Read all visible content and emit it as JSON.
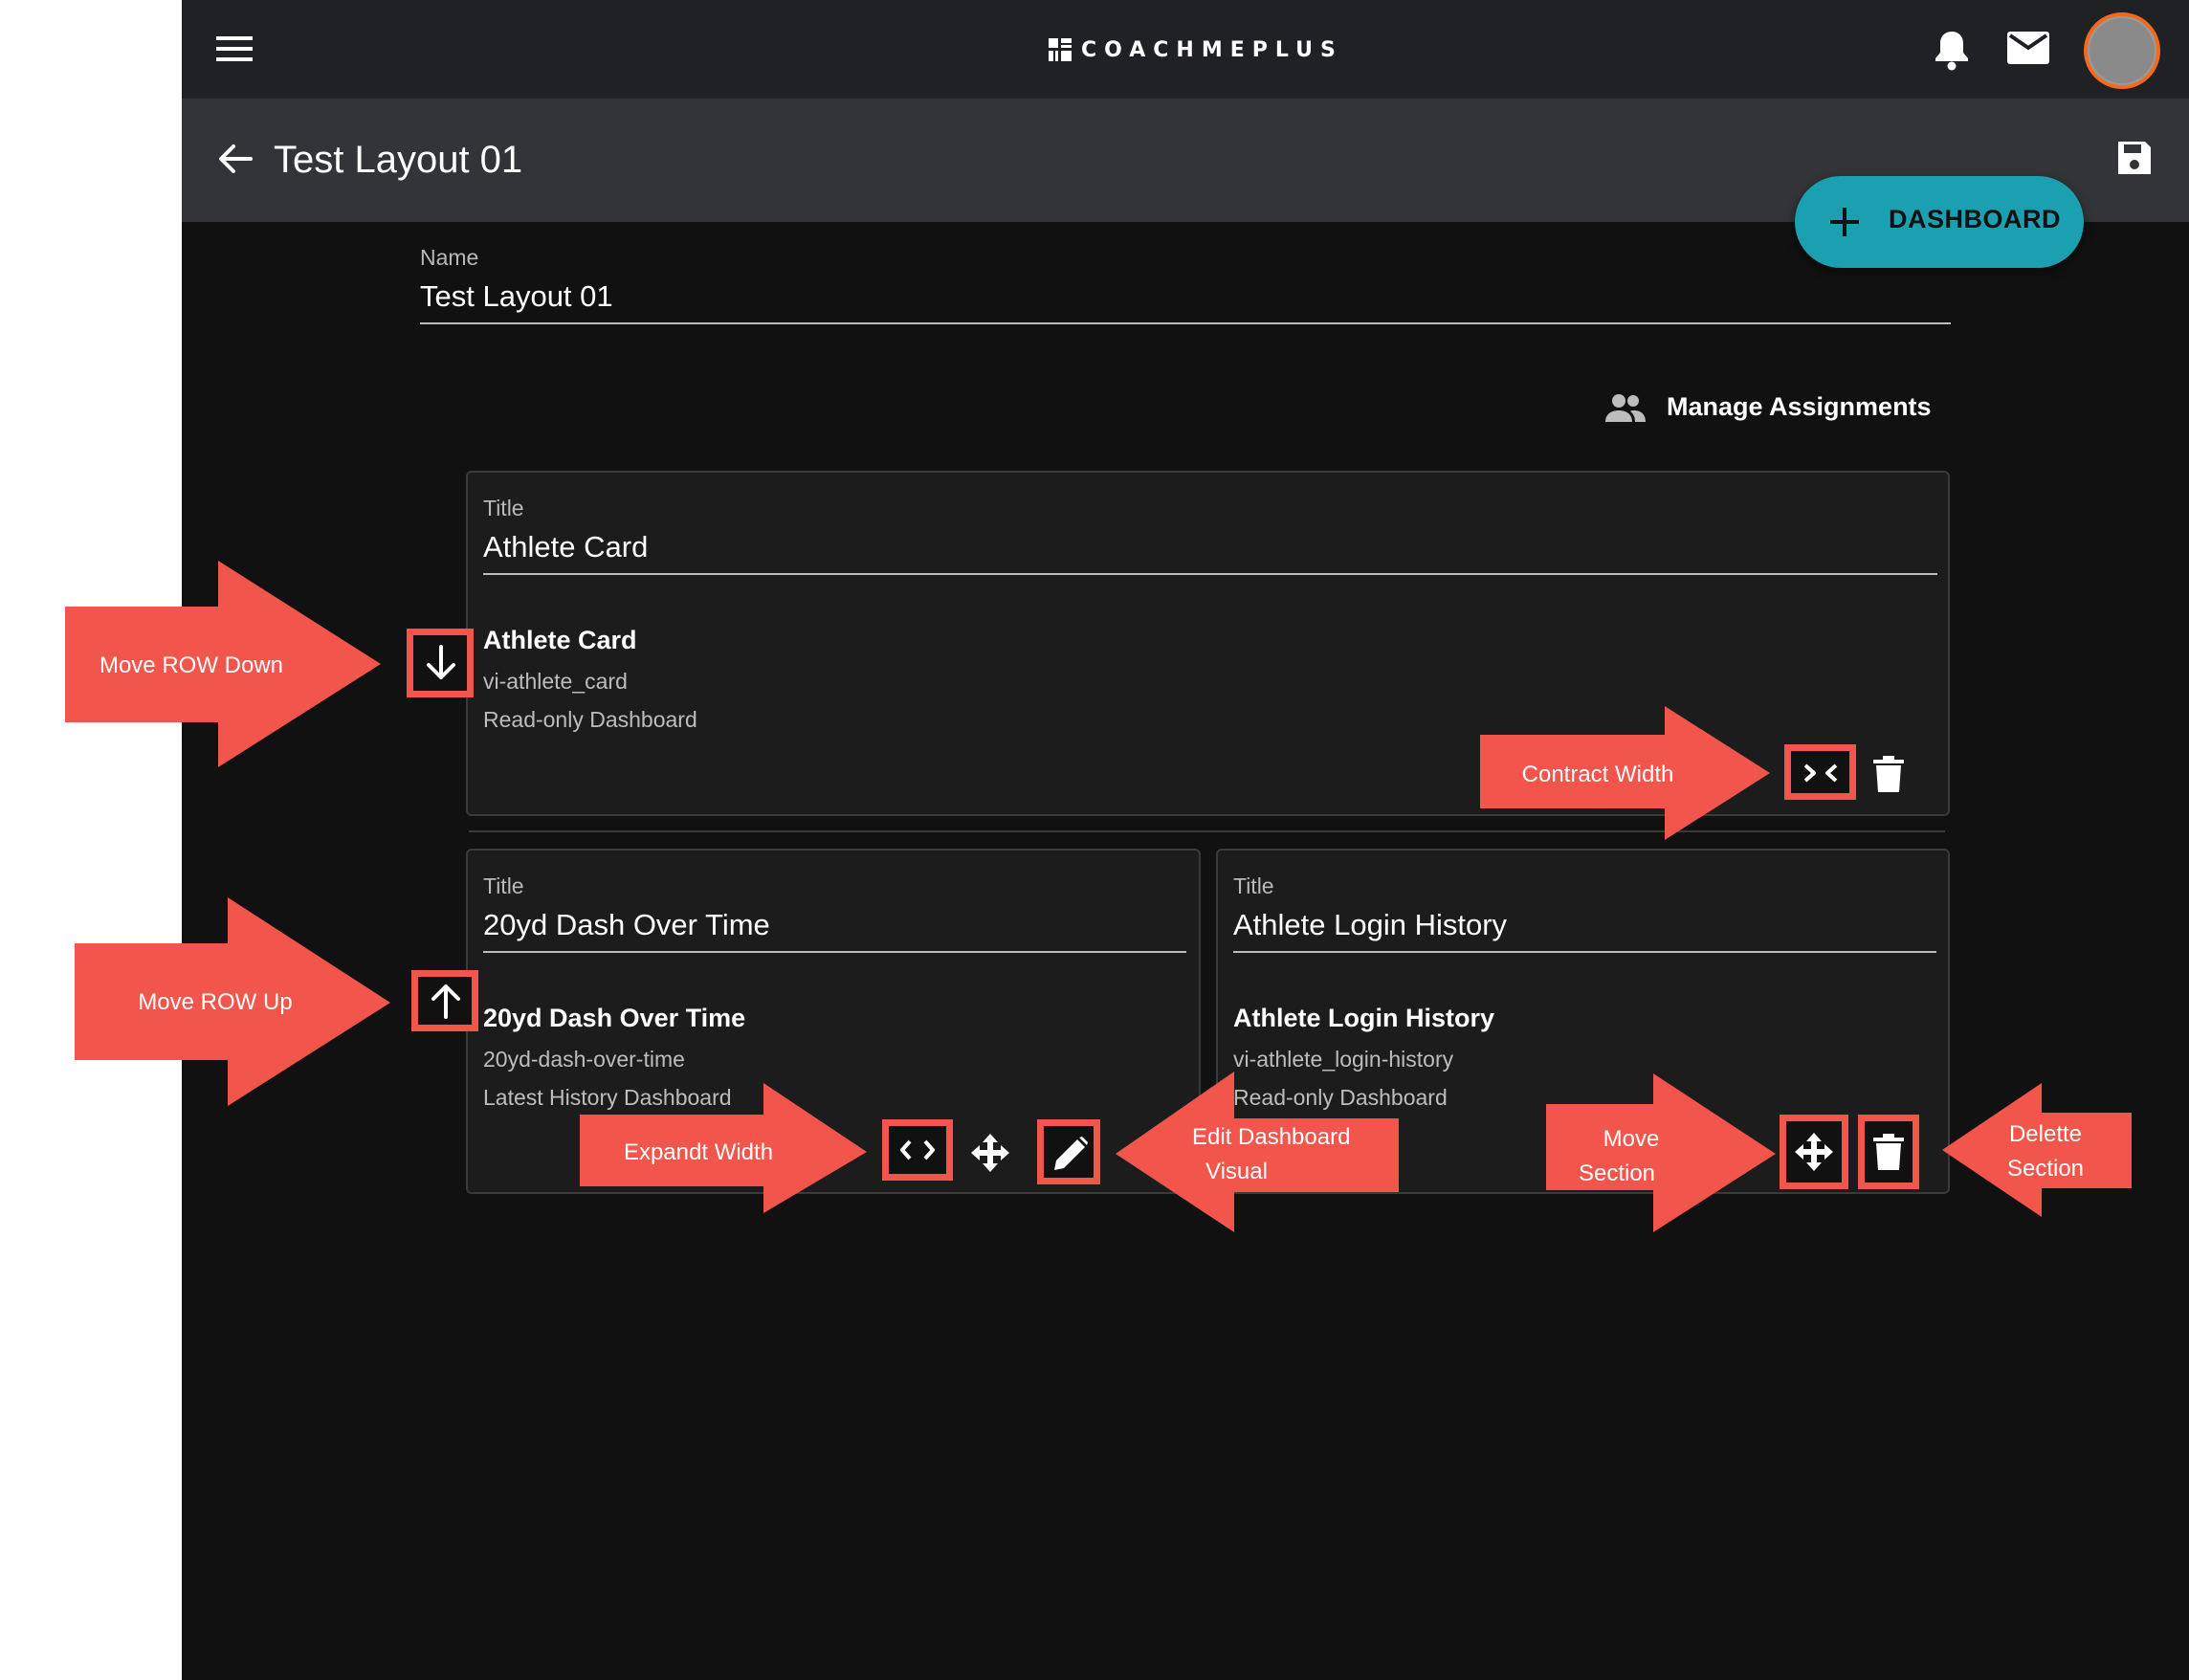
{
  "header": {
    "brand": "COACHMEPLUS",
    "title": "Test Layout 01"
  },
  "fab": {
    "label": "DASHBOARD"
  },
  "form": {
    "name_label": "Name",
    "name_value": "Test Layout 01"
  },
  "manage_assignments": "Manage Assignments",
  "rows": [
    {
      "sections": [
        {
          "title_label": "Title",
          "title_value": "Athlete Card",
          "visual_name": "Athlete Card",
          "visual_id": "vi-athlete_card",
          "visual_type": "Read-only Dashboard"
        }
      ]
    },
    {
      "sections": [
        {
          "title_label": "Title",
          "title_value": "20yd Dash Over Time",
          "visual_name": "20yd Dash Over Time",
          "visual_id": "20yd-dash-over-time",
          "visual_type": "Latest History Dashboard"
        },
        {
          "title_label": "Title",
          "title_value": "Athlete Login History",
          "visual_name": "Athlete Login History",
          "visual_id": "vi-athlete_login-history",
          "visual_type": "Read-only Dashboard"
        }
      ]
    }
  ],
  "annotations": {
    "move_row_down": "Move ROW Down",
    "move_row_up": "Move ROW Up",
    "contract_width": "Contract Width",
    "expand_width": "Expandt Width",
    "edit_visual_1": "Edit Dashboard",
    "edit_visual_2": "Visual",
    "move_section_1": "Move",
    "move_section_2": "Section",
    "delete_section_1": "Delette",
    "delete_section_2": "Section"
  },
  "colors": {
    "accent": "#1aa0b0",
    "annotation": "#f1554b",
    "header_bg": "#202124",
    "subheader_bg": "#323438",
    "canvas_bg": "#111111",
    "avatar_ring": "#f26b1d"
  }
}
